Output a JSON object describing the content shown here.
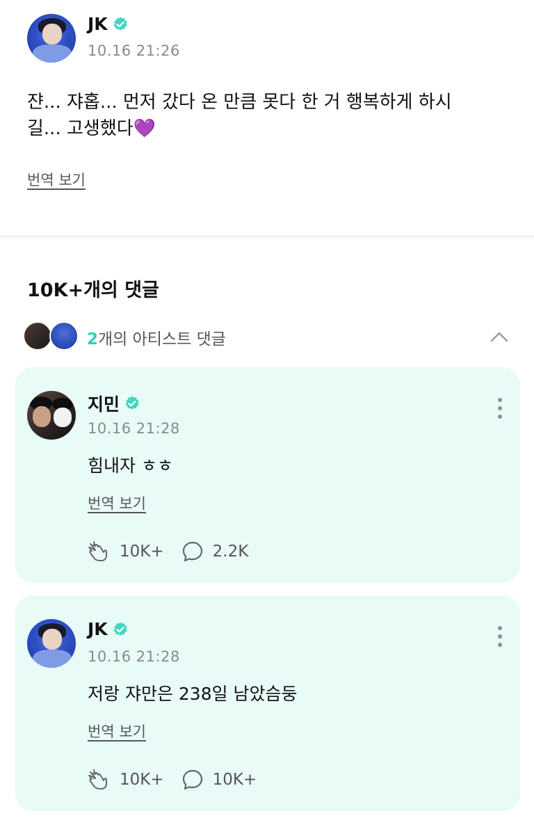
{
  "post": {
    "author": "JK",
    "time": "10.16 21:26",
    "text_line1": "쟌... 쟈홉... 먼저 갔다 온 만큼 못다 한 거 행복하게 하시",
    "text_line2": "길... 고생했다",
    "emoji": "💜",
    "translate_label": "번역 보기"
  },
  "comments_section": {
    "title": "10K+개의 댓글",
    "artist_count": "2",
    "artist_label": "개의 아티스트 댓글"
  },
  "comments": [
    {
      "author": "지민",
      "time": "10.16 21:28",
      "text": "힘내자 ㅎㅎ",
      "translate_label": "번역 보기",
      "likes": "10K+",
      "replies": "2.2K"
    },
    {
      "author": "JK",
      "time": "10.16 21:28",
      "text": "저랑 쟈만은 238일 남았슴둥",
      "translate_label": "번역 보기",
      "likes": "10K+",
      "replies": "10K+"
    }
  ],
  "colors": {
    "accent": "#2fd1b6",
    "card_bg": "#e8fbf7",
    "verified": "#3fd6c2"
  },
  "icons": {
    "verified": "verified-badge-icon",
    "like": "cheer-hand-icon",
    "reply": "speech-bubble-icon",
    "more": "more-vertical-icon",
    "collapse": "chevron-up-icon"
  }
}
